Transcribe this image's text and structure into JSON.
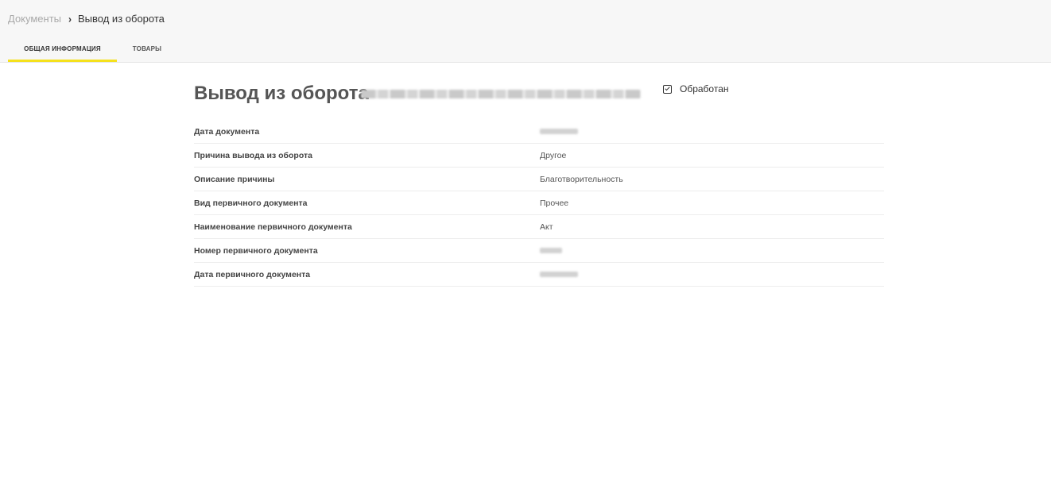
{
  "breadcrumb": {
    "parent": "Документы",
    "separator": "›",
    "current": "Вывод из оборота"
  },
  "tabs": [
    {
      "label": "ОБЩАЯ ИНФОРМАЦИЯ",
      "active": true
    },
    {
      "label": "ТОВАРЫ",
      "active": false
    }
  ],
  "document": {
    "title": "Вывод из оборота",
    "status_label": "Обработан",
    "status_checked": true
  },
  "fields": [
    {
      "label": "Дата документа",
      "value": ""
    },
    {
      "label": "Причина вывода из оборота",
      "value": "Другое"
    },
    {
      "label": "Описание причины",
      "value": "Благотворительность"
    },
    {
      "label": "Вид первичного документа",
      "value": "Прочее"
    },
    {
      "label": "Наименование первичного документа",
      "value": "Акт"
    },
    {
      "label": "Номер первичного документа",
      "value": ""
    },
    {
      "label": "Дата первичного документа",
      "value": ""
    }
  ],
  "colors": {
    "accent": "#f5e11d",
    "topbar_bg": "#f7f7f7"
  }
}
